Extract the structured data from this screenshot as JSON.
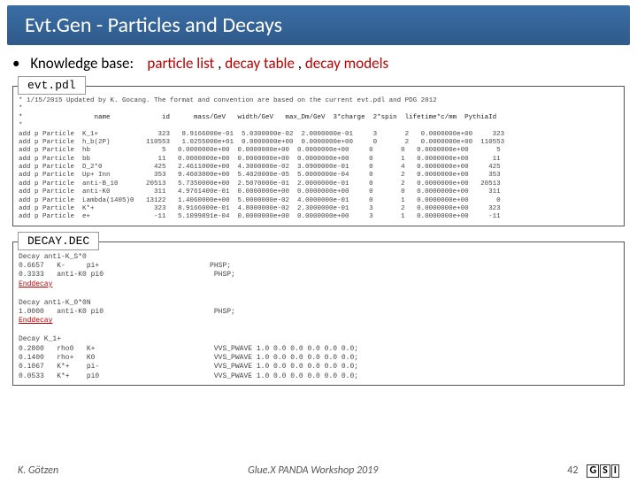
{
  "title": "Evt.Gen - Particles and Decays",
  "kb": {
    "bullet": "•",
    "label": "Knowledge base:",
    "items": [
      "particle list",
      "decay table",
      "decay models"
    ],
    "sep": " , "
  },
  "pdl": {
    "tag": "evt.pdl",
    "comment": "* 1/15/2015 Updated by K. Gocang. The format and convention are based on the current evt.pdl and PDG 2012",
    "sep": "*",
    "header": "*                  name             id      mass/GeV   width/GeV   max_Dm/GeV  3*charge  2*spin  lifetime*c/mm  PythiaId",
    "rows": [
      "add p Particle  K_1+               323   8.9166000e-01  5.0300000e-02  2.0000000e-01     3       2   0.0000000e+00     323",
      "add p Particle  h_b(2P)         110553   1.0255000e+01  0.0000000e+00  0.0000000e+00     0       2   0.0000000e+00  110553",
      "add p Particle  hb                  5   0.0000000e+00  0.0000000e+00  0.0000000e+00     0       0   0.0000000e+00       5",
      "add p Particle  bb                 11   0.0000000e+00  0.0000000e+00  0.0000000e+00     0       1   0.0000000e+00      11",
      "add p Particle  D_2*0             425   2.4611000e+00  4.3000000e-02  3.0900000e-01     0       4   0.0000000e+00     425",
      "add p Particle  Up+ Inn           353   9.4603000e+00  5.4020000e-05  5.0000000e-04     0       2   0.0000000e+00     353",
      "add p Particle  anti-B_10       20513   5.7350000e+00  2.5070000e-01  2.0000000e-01     0       2   0.0000000e+00   20513",
      "add p Particle  anti-K0           311   4.9761400e-01  0.0000000e+00  0.0000000e+00     0       0   0.0000000e+00     311",
      "add p Particle  Lambda(1405)0   13122   1.4060000e+00  5.0000000e-02  4.0000000e-01     0       1   0.0000000e+00       0",
      "add p Particle  K*+               323   8.9166000e-01  4.8000000e-02  2.3000000e-01     3       2   0.0000000e+00     323",
      "add p Particle  e+                -11   5.1099891e-04  0.0000000e+00  0.0000000e+00     3       1   0.0000000e+00     -11"
    ]
  },
  "dec": {
    "tag": "DECAY.DEC",
    "blocks": [
      {
        "head": "Decay anti-K_S*0",
        "rows": [
          "0.6657   K-     pi+                          PHSP;",
          "0.3333   anti-K0 pi0                          PHSP;"
        ],
        "end": "Enddecay"
      },
      {
        "head": "Decay anti-K_0*0N",
        "rows": [
          "1.0000   anti-K0 pi0                          PHSP;"
        ],
        "end": "Enddecay"
      },
      {
        "head": "Decay K_1+",
        "rows": [
          "0.2800   rho0   K+                            VVS_PWAVE 1.0 0.0 0.0 0.0 0.0 0.0;",
          "0.1400   rho+   K0                            VVS_PWAVE 1.0 0.0 0.0 0.0 0.0 0.0;",
          "0.1067   K*+    pi-                           VVS_PWAVE 1.0 0.0 0.0 0.0 0.0 0.0;",
          "0.0533   K*+    pi0                           VVS_PWAVE 1.0 0.0 0.0 0.0 0.0 0.0;"
        ],
        "end": ""
      }
    ]
  },
  "footer": {
    "author": "K. Götzen",
    "center": "Glue.X PANDA Workshop 2019",
    "page": "42",
    "logo": [
      "G",
      "S",
      "I"
    ]
  }
}
